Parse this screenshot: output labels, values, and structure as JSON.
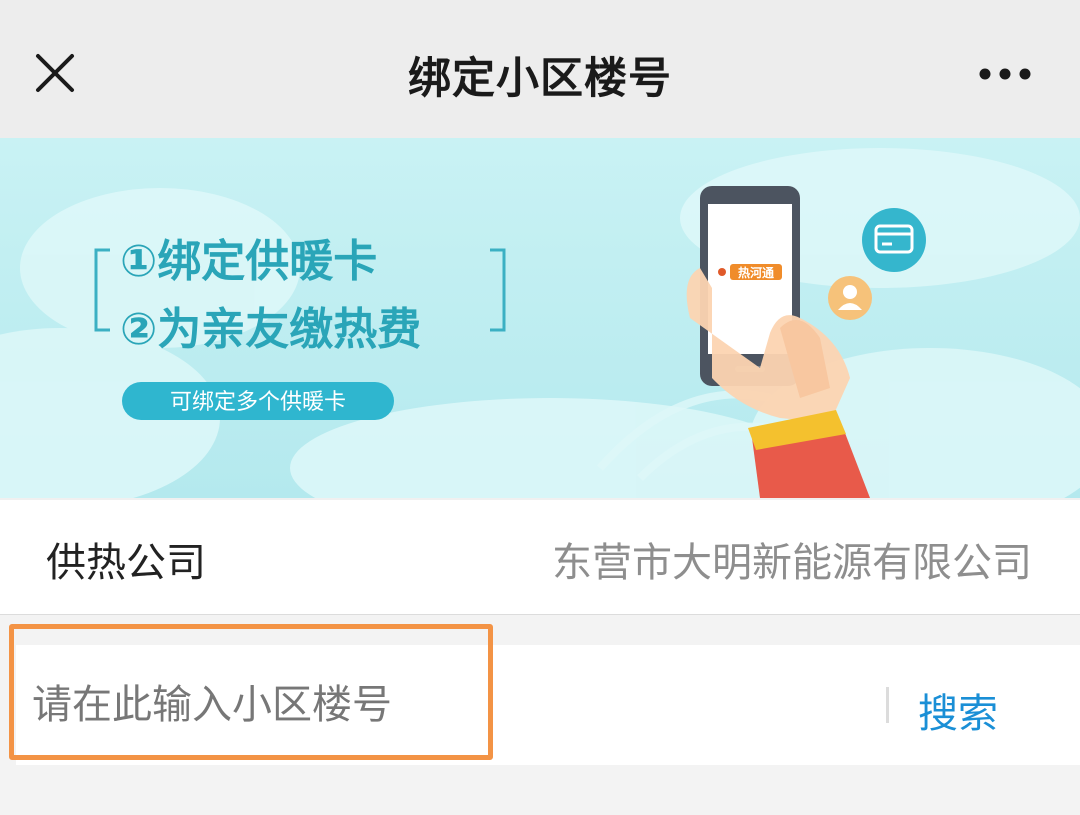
{
  "navbar": {
    "title": "绑定小区楼号",
    "close_icon": "close-icon",
    "more_icon": "more-icon"
  },
  "banner": {
    "line1": "①绑定供暖卡",
    "line2": "②为亲友缴热费",
    "pill": "可绑定多个供暖卡",
    "app_logo": "热河通",
    "colors": {
      "sky": "#c8f1f3",
      "accent": "#2aa5b8",
      "pill": "#2fb6cf"
    }
  },
  "company": {
    "label": "供热公司",
    "value": "东营市大明新能源有限公司"
  },
  "search": {
    "placeholder": "请在此输入小区楼号",
    "value": "",
    "button_label": "搜索",
    "highlight_color": "#f39345"
  }
}
